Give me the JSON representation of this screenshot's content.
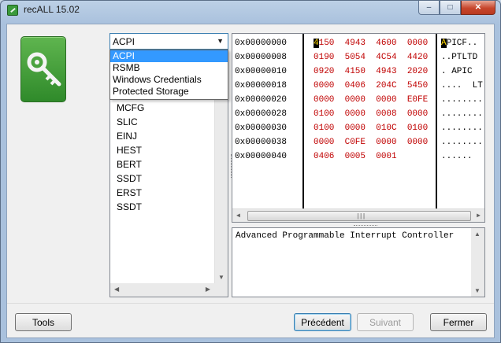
{
  "window": {
    "title": "recALL 15.02",
    "controls": {
      "minimize": "–",
      "maximize": "□",
      "close": "✕"
    }
  },
  "logo_icon": "key-icon",
  "table_type_select": {
    "selected": "ACPI",
    "options": [
      "ACPI",
      "RSMB",
      "Windows Credentials",
      "Protected Storage"
    ]
  },
  "table_list": [
    "MCFG",
    "SLIC",
    "EINJ",
    "HEST",
    "BERT",
    "SSDT",
    "ERST",
    "SSDT"
  ],
  "hex_view": {
    "rows": [
      {
        "addr": "0x00000000",
        "cursor": "4",
        "bytes": "150  4943  4600  0000",
        "ascii_cursor": "A",
        "ascii": "PICF.."
      },
      {
        "addr": "0x00000008",
        "cursor": "",
        "bytes": "0190  5054  4C54  4420",
        "ascii_cursor": "",
        "ascii": "..PTLTD"
      },
      {
        "addr": "0x00000010",
        "cursor": "",
        "bytes": "0920  4150  4943  2020",
        "ascii_cursor": "",
        "ascii": ". APIC"
      },
      {
        "addr": "0x00000018",
        "cursor": "",
        "bytes": "0000  0406  204C  5450",
        "ascii_cursor": "",
        "ascii": "....  LT"
      },
      {
        "addr": "0x00000020",
        "cursor": "",
        "bytes": "0000  0000  0000  E0FE",
        "ascii_cursor": "",
        "ascii": "........"
      },
      {
        "addr": "0x00000028",
        "cursor": "",
        "bytes": "0100  0000  0008  0000",
        "ascii_cursor": "",
        "ascii": "........"
      },
      {
        "addr": "0x00000030",
        "cursor": "",
        "bytes": "0100  0000  010C  0100",
        "ascii_cursor": "",
        "ascii": "........"
      },
      {
        "addr": "0x00000038",
        "cursor": "",
        "bytes": "0000  C0FE  0000  0000",
        "ascii_cursor": "",
        "ascii": "........"
      },
      {
        "addr": "0x00000040",
        "cursor": "",
        "bytes": "0406  0005  0001",
        "ascii_cursor": "",
        "ascii": "......"
      }
    ],
    "scrollbar_grip": "|||"
  },
  "description": "Advanced Programmable Interrupt Controller",
  "buttons": {
    "tools": "Tools",
    "previous": "Précédent",
    "next": "Suivant",
    "close": "Fermer"
  },
  "colors": {
    "bytes": "#c00000",
    "selection": "#3399ff",
    "logo": "#3a9a3a"
  }
}
